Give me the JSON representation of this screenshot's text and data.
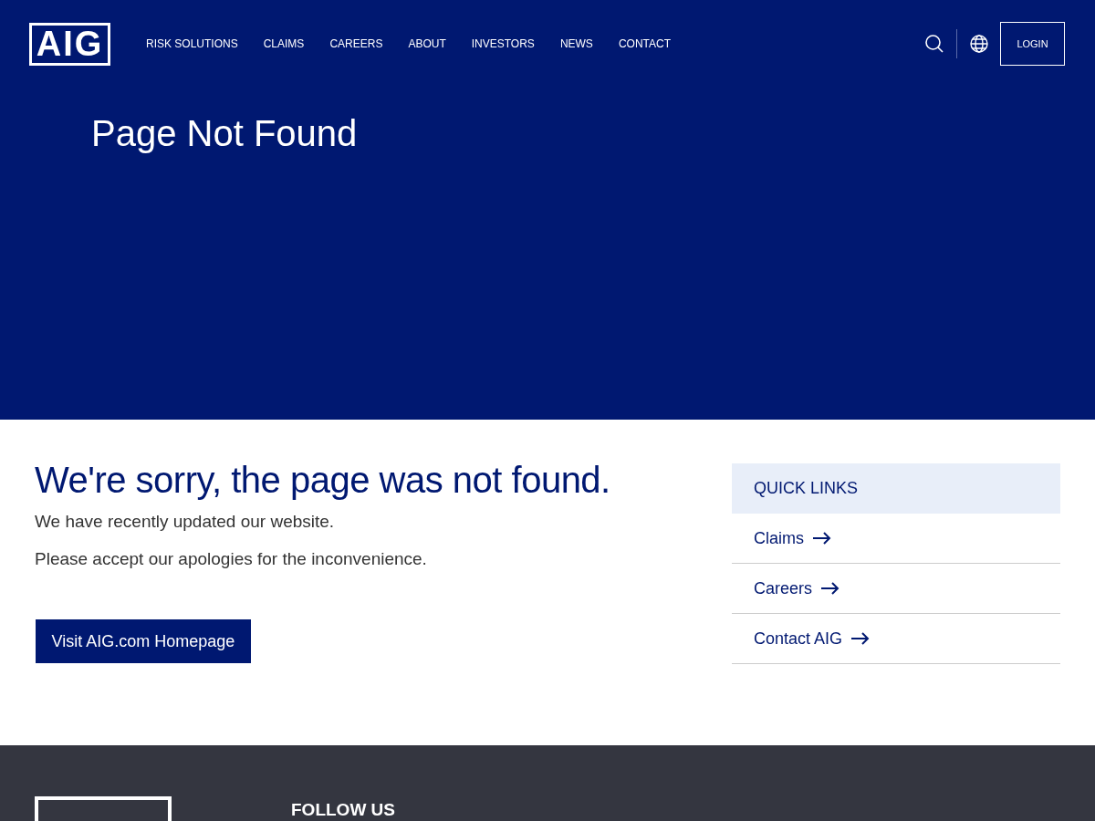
{
  "header": {
    "logo": "AIG",
    "nav": [
      {
        "label": "RISK SOLUTIONS"
      },
      {
        "label": "CLAIMS"
      },
      {
        "label": "CAREERS"
      },
      {
        "label": "ABOUT"
      },
      {
        "label": "INVESTORS"
      },
      {
        "label": "NEWS"
      },
      {
        "label": "CONTACT"
      }
    ],
    "login": "LOGIN"
  },
  "hero": {
    "title": "Page Not Found"
  },
  "content": {
    "heading": "We're sorry, the page was not found.",
    "paragraphs": [
      "We have recently updated our website.",
      "Please accept our apologies for the inconvenience."
    ],
    "button": "Visit AIG.com Homepage"
  },
  "quick_links": {
    "title": "QUICK LINKS",
    "items": [
      {
        "label": "Claims"
      },
      {
        "label": "Careers"
      },
      {
        "label": "Contact AIG"
      }
    ]
  },
  "footer": {
    "follow_title": "FOLLOW US"
  }
}
